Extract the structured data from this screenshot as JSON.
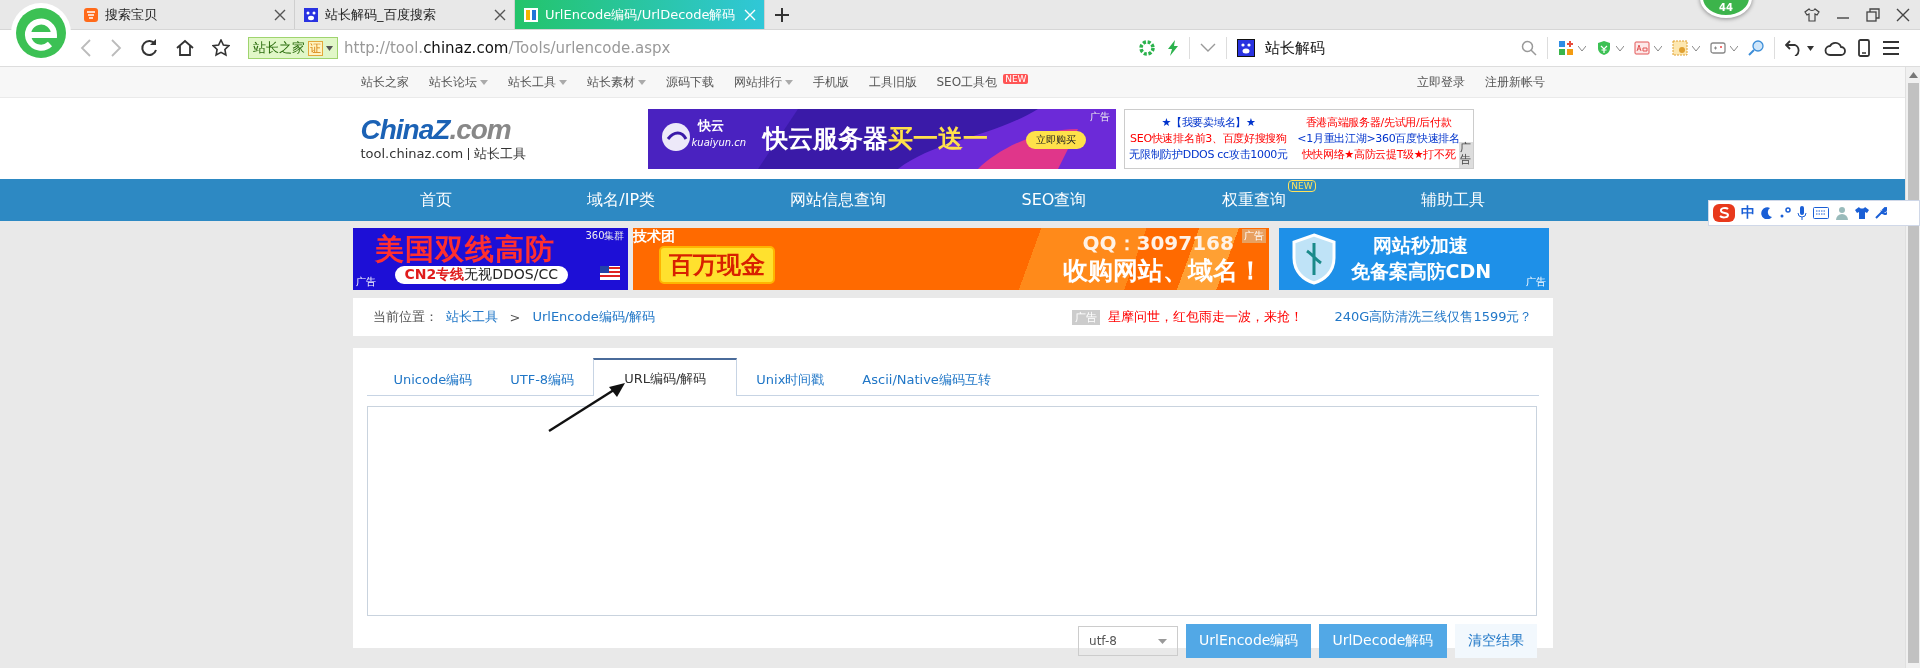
{
  "browser": {
    "tabs": [
      {
        "label": "搜索宝贝",
        "selected": false
      },
      {
        "label": "站长解码_百度搜索",
        "selected": false
      },
      {
        "label": "UrlEncode编码/UrlDecode解码",
        "selected": true
      }
    ],
    "notification_count": "44",
    "address": {
      "site_badge": "站长之家",
      "cert_badge": "证",
      "url_prefix": "http://tool.",
      "url_domain": "chinaz.com",
      "url_path": "/Tools/urlencode.aspx"
    },
    "search": {
      "value": "站长解码"
    }
  },
  "page": {
    "top_links": [
      {
        "label": "站长之家",
        "dropdown": false
      },
      {
        "label": "站长论坛",
        "dropdown": true
      },
      {
        "label": "站长工具",
        "dropdown": true
      },
      {
        "label": "站长素材",
        "dropdown": true
      },
      {
        "label": "源码下载",
        "dropdown": false
      },
      {
        "label": "网站排行",
        "dropdown": true
      },
      {
        "label": "手机版",
        "dropdown": false
      },
      {
        "label": "工具旧版",
        "dropdown": false
      },
      {
        "label": "SEO工具包",
        "dropdown": false,
        "badge": "NEW"
      }
    ],
    "account_links": [
      "立即登录",
      "注册新帐号"
    ],
    "logo": {
      "brand": "ChinaZ",
      "suffix": ".com",
      "domain": "tool.chinaz.com",
      "section": "站长工具"
    },
    "header_ad": {
      "brand": "快云",
      "brand_domain": "kuaiyun.cn",
      "title": "快云服务器",
      "promo": "买一送一",
      "cta": "立即购买",
      "ad_label": "广告"
    },
    "text_ad": {
      "left": [
        "★【我要卖域名】★",
        "SEO快速排名前3、百度好搜搜狗",
        "无限制防护DDOS cc攻击1000元"
      ],
      "right": [
        "香港高端服务器/先试用/后付款",
        "<1月重出江湖>360百度快速排名",
        "快快网络★高防云提T级★打不死"
      ],
      "ad_label": "广告"
    },
    "nav": [
      {
        "label": "首页"
      },
      {
        "label": "域名/IP类"
      },
      {
        "label": "网站信息查询"
      },
      {
        "label": "SEO查询"
      },
      {
        "label": "权重查询",
        "badge": "NEW"
      },
      {
        "label": "辅助工具"
      }
    ],
    "banners": [
      {
        "kind": "ddos",
        "title": "美国双线高防",
        "corner": "360集群",
        "tag": "CN2专线",
        "subtitle": "无视DDOS/CC",
        "ad_label": "广告"
      },
      {
        "kind": "cash",
        "overlay": "技术团",
        "title": "百万现金",
        "contact": "QQ：3097168",
        "subtitle": "收购网站、域名！",
        "ad_label": "广告"
      },
      {
        "kind": "cdn",
        "title": "网站秒加速",
        "subtitle": "免备案高防CDN",
        "ad_label": "广告"
      }
    ],
    "breadcrumb": {
      "label": "当前位置：",
      "items": [
        "站长工具",
        "UrlEncode编码/解码"
      ],
      "separator": ">"
    },
    "promo": {
      "ad_label": "广告",
      "text": "星摩问世，红包雨走一波，来抢！",
      "link": "240G高防清洗三线仅售1599元？"
    },
    "tool_tabs": [
      {
        "label": "Unicode编码",
        "selected": false
      },
      {
        "label": "UTF-8编码",
        "selected": false
      },
      {
        "label": "URL编码/解码",
        "selected": true
      },
      {
        "label": "Unix时间戳",
        "selected": false
      },
      {
        "label": "Ascii/Native编码互转",
        "selected": false
      }
    ],
    "charset": "utf-8",
    "buttons": [
      {
        "label": "UrlEncode编码",
        "kind": "primary"
      },
      {
        "label": "UrlDecode解码",
        "kind": "primary"
      },
      {
        "label": "清空结果",
        "kind": "plain"
      }
    ]
  },
  "ime_toolbar": {
    "mode": "中"
  }
}
